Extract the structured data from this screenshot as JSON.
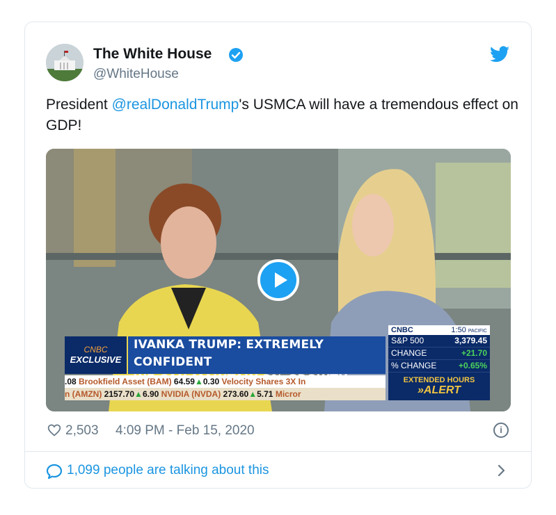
{
  "tweet": {
    "author_name": "The White House",
    "handle": "@WhiteHouse",
    "text_before": "President ",
    "mention": "@realDonaldTrump",
    "text_after": "'s USMCA will have a tremendous effect on GDP!",
    "likes": "2,503",
    "timestamp": "4:09 PM - Feb 15, 2020",
    "talking": "1,099 people are talking about this",
    "accent_color": "#1da1f2"
  },
  "video": {
    "exclusive_brand": "CNBC",
    "exclusive_label": "EXCLUSIVE",
    "headline_line1": "IVANKA TRUMP: EXTREMELY CONFIDENT",
    "headline_line2": "WE CAN MAINTAIN 2% GROWTH",
    "ticker_row1": [
      {
        "text": ".08 ",
        "cls": "num"
      },
      {
        "text": "Brookfield Asset (BAM) ",
        "cls": ""
      },
      {
        "text": "64.59",
        "cls": "num"
      },
      {
        "text": "▲",
        "cls": "up"
      },
      {
        "text": "0.30 ",
        "cls": "num"
      },
      {
        "text": "Velocity Shares 3X In",
        "cls": ""
      }
    ],
    "ticker_row2": [
      {
        "text": "n (AMZN) ",
        "cls": ""
      },
      {
        "text": "2157.70",
        "cls": "num"
      },
      {
        "text": "▲",
        "cls": "up"
      },
      {
        "text": "6.90 ",
        "cls": "num"
      },
      {
        "text": "NVIDIA (NVDA) ",
        "cls": ""
      },
      {
        "text": "273.60",
        "cls": "num"
      },
      {
        "text": "▲",
        "cls": "up"
      },
      {
        "text": "5.71 ",
        "cls": "num"
      },
      {
        "text": "Micror",
        "cls": ""
      }
    ],
    "quote_brand": "CNBC",
    "quote_time": "1:50",
    "quote_time_suffix": "PACIFIC",
    "quotes": [
      {
        "label": "S&P 500",
        "value": "3,379.45",
        "white": true
      },
      {
        "label": "CHANGE",
        "value": "+21.70",
        "white": false
      },
      {
        "label": "% CHANGE",
        "value": "+0.65%",
        "white": false
      }
    ],
    "extended_hours": "EXTENDED HOURS",
    "alert": "ALERT"
  }
}
